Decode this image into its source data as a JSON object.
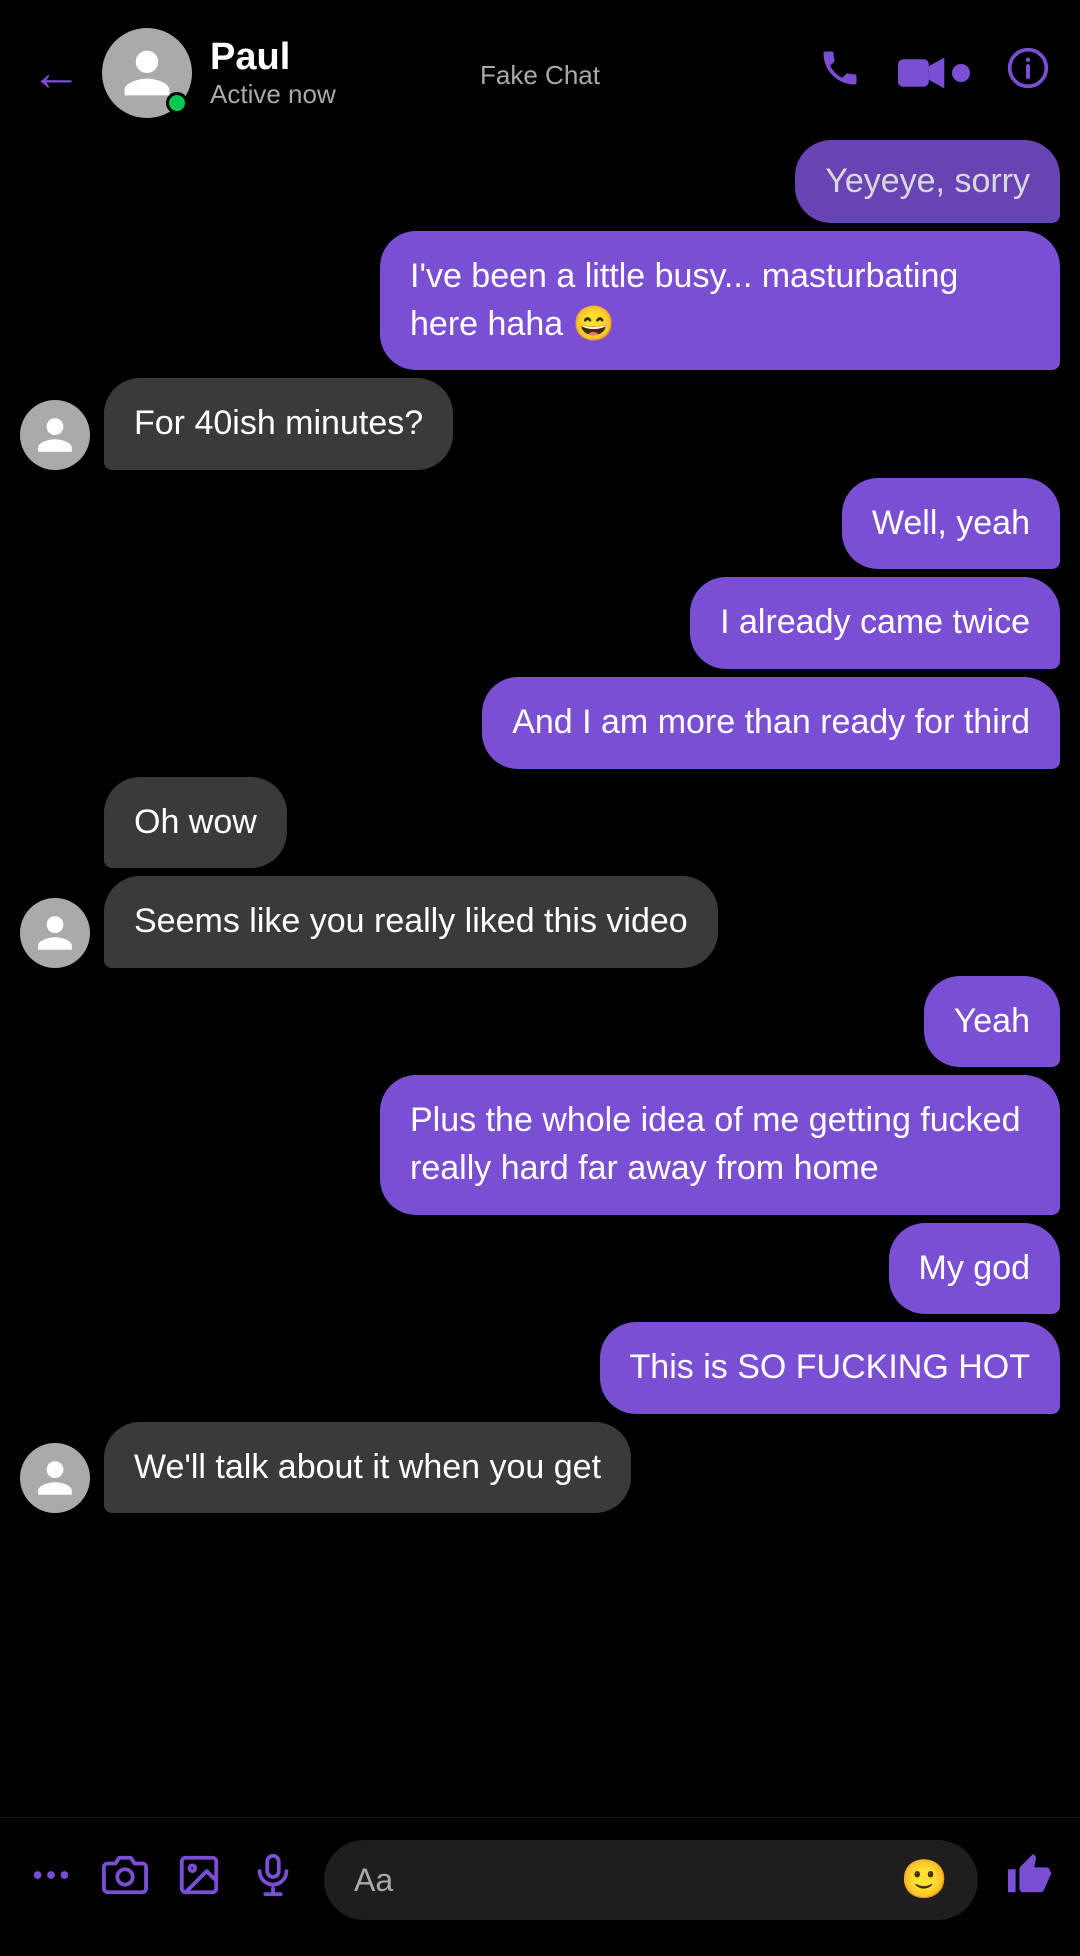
{
  "header": {
    "back_label": "←",
    "name": "Paul",
    "status": "Active now",
    "fake_label": "Fake Chat",
    "call_icon": "phone",
    "video_icon": "video",
    "info_icon": "info"
  },
  "messages": [
    {
      "id": 1,
      "type": "sent",
      "text": "Yeyeye, sorry",
      "partial": true
    },
    {
      "id": 2,
      "type": "sent",
      "text": "I've been a little busy... masturbating here haha 😄"
    },
    {
      "id": 3,
      "type": "received",
      "text": "For 40ish minutes?",
      "show_avatar": true
    },
    {
      "id": 4,
      "type": "sent",
      "text": "Well, yeah"
    },
    {
      "id": 5,
      "type": "sent",
      "text": "I already came twice"
    },
    {
      "id": 6,
      "type": "sent",
      "text": "And I am more than ready for third"
    },
    {
      "id": 7,
      "type": "received",
      "text": "Oh wow",
      "show_avatar": false
    },
    {
      "id": 8,
      "type": "received",
      "text": "Seems like you really liked this video",
      "show_avatar": true
    },
    {
      "id": 9,
      "type": "sent",
      "text": "Yeah"
    },
    {
      "id": 10,
      "type": "sent",
      "text": "Plus the whole idea of me getting fucked really hard far away from home"
    },
    {
      "id": 11,
      "type": "sent",
      "text": "My god"
    },
    {
      "id": 12,
      "type": "sent",
      "text": "This is SO FUCKING HOT"
    },
    {
      "id": 13,
      "type": "received",
      "text": "We'll talk about it when you get",
      "partial": true,
      "show_avatar": true
    }
  ],
  "bottom_bar": {
    "input_placeholder": "Aa"
  }
}
